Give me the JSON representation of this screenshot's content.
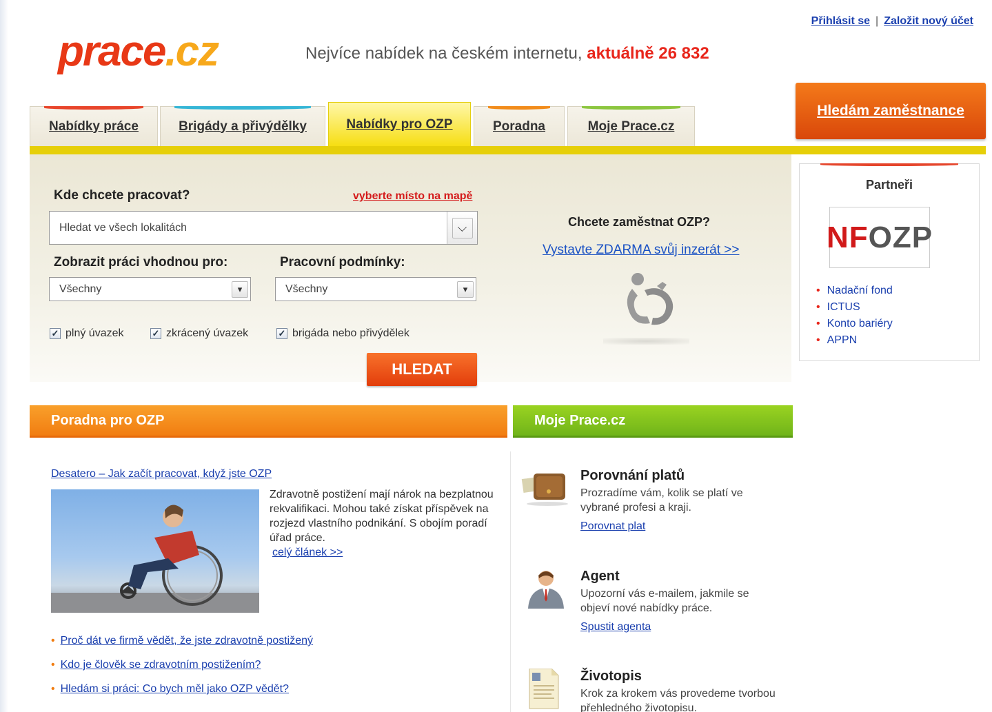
{
  "header": {
    "login_label": "Přihlásit se",
    "separator": "|",
    "register_label": "Založit nový účet",
    "logo_word": "prace",
    "logo_domain": ".cz",
    "tagline_prefix": "Nejvíce nabídek na českém internetu,",
    "tagline_count": "aktuálně 26 832"
  },
  "tabs": [
    {
      "label": "Nabídky práce",
      "accent": "#e8452b"
    },
    {
      "label": "Brigády a přivýdělky",
      "accent": "#35b6d6"
    },
    {
      "label": "Nabídky pro OZP",
      "accent": "#e6cf09",
      "active": true
    },
    {
      "label": "Poradna",
      "accent": "#f28c1b"
    },
    {
      "label": "Moje Prace.cz",
      "accent": "#8cc63f"
    }
  ],
  "employer_button": "Hledám zaměstnance",
  "search": {
    "where_label": "Kde chcete pracovat?",
    "map_link": "vyberte místo na mapě",
    "location_value": "Hledat ve všech lokalitách",
    "suitable_label": "Zobrazit práci vhodnou pro:",
    "suitable_value": "Všechny",
    "conditions_label": "Pracovní podmínky:",
    "conditions_value": "Všechny",
    "checkboxes": [
      {
        "label": "plný úvazek",
        "checked": true
      },
      {
        "label": "zkrácený úvazek",
        "checked": true
      },
      {
        "label": "brigáda nebo přivýdělek",
        "checked": true
      }
    ],
    "submit_label": "HLEDAT"
  },
  "ozp_promo": {
    "title": "Chcete zaměstnat OZP?",
    "link": "Vystavte ZDARMA svůj inzerát >>",
    "icon": "wheelchair-handshake-icon"
  },
  "partners": {
    "title": "Partneři",
    "logo_nf": "NF",
    "logo_ozp": "OZP",
    "links": [
      "Nadační fond",
      "ICTUS",
      "Konto bariéry",
      "APPN"
    ]
  },
  "poradna": {
    "header": "Poradna pro OZP",
    "article_title": "Desatero – Jak začít pracovat, když jste OZP",
    "article_text": "Zdravotně postižení mají nárok na bezplatnou rekvalifikaci. Mohou také získat příspěvek na rozjezd vlastního podnikání. S obojím poradí úřad práce.",
    "article_more": "celý článek >>",
    "links": [
      "Proč dát ve firmě vědět, že jste zdravotně postižený",
      "Kdo je člověk se zdravotním postižením?",
      "Hledám si práci: Co bych měl jako OZP vědět?"
    ]
  },
  "moje": {
    "header": "Moje Prace.cz",
    "features": [
      {
        "title": "Porovnání platů",
        "desc": "Prozradíme vám, kolik se platí ve vybrané profesi a kraji.",
        "link": "Porovnat plat",
        "icon": "wallet-icon"
      },
      {
        "title": "Agent",
        "desc": "Upozorní vás e-mailem, jakmile se objeví nové nabídky práce.",
        "link": "Spustit agenta",
        "icon": "agent-person-icon"
      },
      {
        "title": "Životopis",
        "desc": "Krok za krokem vás provedeme tvorbou přehledného životopisu.",
        "link": "",
        "icon": "cv-document-icon"
      }
    ]
  },
  "colors": {
    "brand_red": "#e83816",
    "brand_orange": "#f7a81b",
    "accent_yellow": "#e6cf09",
    "link_blue": "#1a3fae"
  }
}
